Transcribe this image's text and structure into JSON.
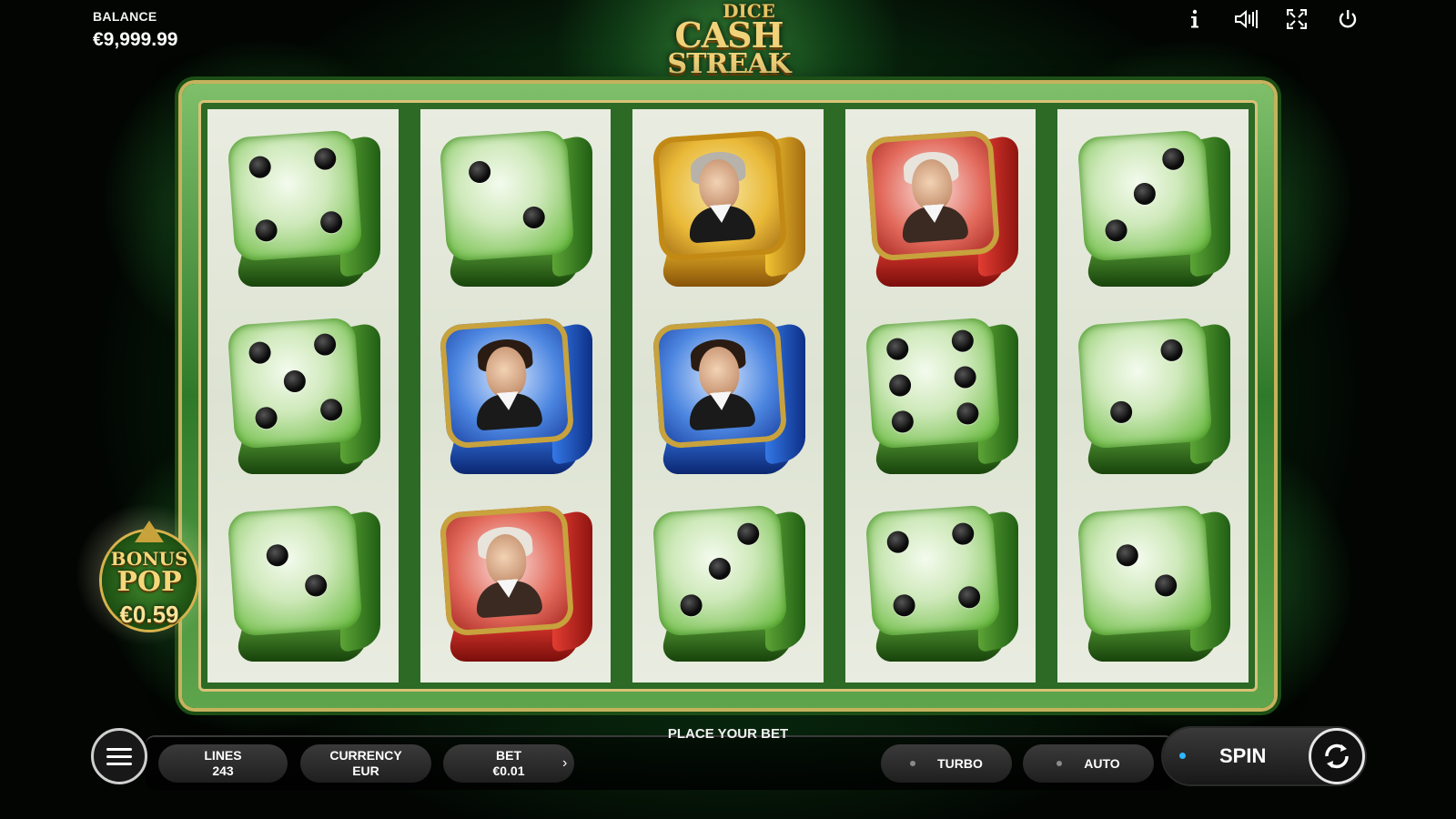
{
  "top": {
    "balance_label": "BALANCE",
    "balance_value": "€9,999.99",
    "logo_line1": "DICE",
    "logo_line2": "CASH",
    "logo_line3": "STREAK",
    "icons": [
      "info-icon",
      "sound-icon",
      "fullscreen-icon",
      "power-icon"
    ]
  },
  "reels": [
    [
      "green-4",
      "green-5",
      "green-2"
    ],
    [
      "green-2",
      "lincoln-blue",
      "washington-red"
    ],
    [
      "jackson-gold",
      "lincoln-blue",
      "green-3"
    ],
    [
      "washington-red",
      "green-6",
      "green-4"
    ],
    [
      "green-3",
      "green-2",
      "green-2"
    ]
  ],
  "bonus_pop": {
    "line1": "BONUS",
    "line2": "POP",
    "value": "€0.59"
  },
  "controls": {
    "status_text": "PLACE YOUR BET",
    "lines_label": "LINES",
    "lines_value": "243",
    "currency_label": "CURRENCY",
    "currency_value": "EUR",
    "bet_label": "BET",
    "bet_value": "€0.01",
    "turbo_label": "TURBO",
    "auto_label": "AUTO",
    "spin_label": "SPIN"
  },
  "colors": {
    "accent_blue": "#2cb7ff",
    "gold": "#f0d27a",
    "felt_green": "#1f7a2e"
  }
}
